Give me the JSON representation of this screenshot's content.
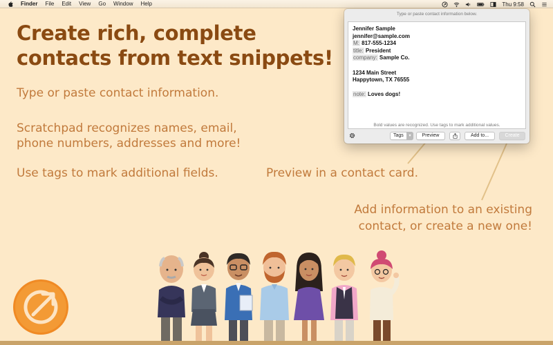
{
  "menubar": {
    "app_name": "Finder",
    "items": [
      "File",
      "Edit",
      "View",
      "Go",
      "Window",
      "Help"
    ],
    "clock": "Thu 9:58",
    "icons": [
      "apple-icon",
      "scratchpad-status-icon",
      "wifi-icon",
      "volume-icon",
      "battery-icon",
      "display-icon",
      "search-icon",
      "list-icon"
    ]
  },
  "headline": {
    "line1": "Create rich, complete",
    "line2": "contacts from text snippets!"
  },
  "features": {
    "type_paste": "Type or paste contact information.",
    "recognizes_line1": "Scratchpad recognizes names, email,",
    "recognizes_line2": "phone numbers, addresses and more!",
    "tags": "Use tags to mark additional fields."
  },
  "callouts": {
    "preview": "Preview in a contact card.",
    "add_line1": "Add information to an existing",
    "add_line2": "contact, or create a new one!"
  },
  "window": {
    "hint_top": "Type or paste contact information below.",
    "hint_bottom": "Bold values are recognized. Use tags to mark additional values.",
    "contact": {
      "name": "Jennifer Sample",
      "email": "jennifer@sample.com",
      "phone_tag": "M:",
      "phone": "817-555-1234",
      "title_tag": "title:",
      "title": "President",
      "company_tag": "company:",
      "company": "Sample Co.",
      "street": "1234 Main Street",
      "city": "Happytown, TX 76555",
      "note_tag": "note:",
      "note": "Loves dogs!"
    },
    "toolbar": {
      "tags_label": "Tags",
      "preview_label": "Preview",
      "addto_label": "Add to...",
      "create_label": "Create"
    }
  },
  "colors": {
    "background": "#fde9c8",
    "headline": "#8a4a12",
    "body_text": "#c17a3c",
    "logo_orange": "#f08a24"
  }
}
